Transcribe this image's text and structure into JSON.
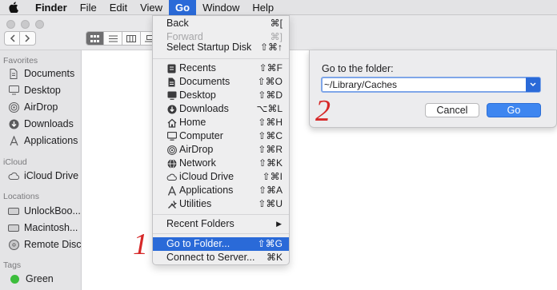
{
  "menubar": {
    "app_name": "Finder",
    "items": [
      "File",
      "Edit",
      "View",
      "Go",
      "Window",
      "Help"
    ],
    "active_item": "Go"
  },
  "sidebar": {
    "favorites_header": "Favorites",
    "favorites": [
      "Documents",
      "Desktop",
      "AirDrop",
      "Downloads",
      "Applications"
    ],
    "icloud_header": "iCloud",
    "icloud": [
      "iCloud Drive"
    ],
    "locations_header": "Locations",
    "locations": [
      "UnlockBoo...",
      "Macintosh...",
      "Remote Disc"
    ],
    "tags_header": "Tags",
    "tags": [
      "Green"
    ]
  },
  "go_menu": {
    "back": {
      "label": "Back",
      "shortcut": "⌘["
    },
    "forward": {
      "label": "Forward",
      "shortcut": "⌘]"
    },
    "startup": {
      "label": "Select Startup Disk",
      "shortcut": "⇧⌘↑"
    },
    "places": [
      {
        "label": "Recents",
        "shortcut": "⇧⌘F",
        "icon": "recents-icon"
      },
      {
        "label": "Documents",
        "shortcut": "⇧⌘O",
        "icon": "documents-icon"
      },
      {
        "label": "Desktop",
        "shortcut": "⇧⌘D",
        "icon": "desktop-icon"
      },
      {
        "label": "Downloads",
        "shortcut": "⌥⌘L",
        "icon": "downloads-icon"
      },
      {
        "label": "Home",
        "shortcut": "⇧⌘H",
        "icon": "home-icon"
      },
      {
        "label": "Computer",
        "shortcut": "⇧⌘C",
        "icon": "computer-icon"
      },
      {
        "label": "AirDrop",
        "shortcut": "⇧⌘R",
        "icon": "airdrop-icon"
      },
      {
        "label": "Network",
        "shortcut": "⇧⌘K",
        "icon": "network-icon"
      },
      {
        "label": "iCloud Drive",
        "shortcut": "⇧⌘I",
        "icon": "cloud-icon"
      },
      {
        "label": "Applications",
        "shortcut": "⇧⌘A",
        "icon": "applications-icon"
      },
      {
        "label": "Utilities",
        "shortcut": "⇧⌘U",
        "icon": "utilities-icon"
      }
    ],
    "recent_folders": {
      "label": "Recent Folders",
      "arrow": "▶"
    },
    "go_to_folder": {
      "label": "Go to Folder...",
      "shortcut": "⇧⌘G"
    },
    "connect": {
      "label": "Connect to Server...",
      "shortcut": "⌘K"
    }
  },
  "dialog": {
    "title": "Go to the folder:",
    "path_value": "~/Library/Caches",
    "cancel_label": "Cancel",
    "go_label": "Go"
  },
  "annotations": {
    "step1": "1",
    "step2": "2"
  },
  "colors": {
    "accent": "#2a6ad8",
    "annotation": "#d62828",
    "tag_green": "#3cbd3c"
  }
}
